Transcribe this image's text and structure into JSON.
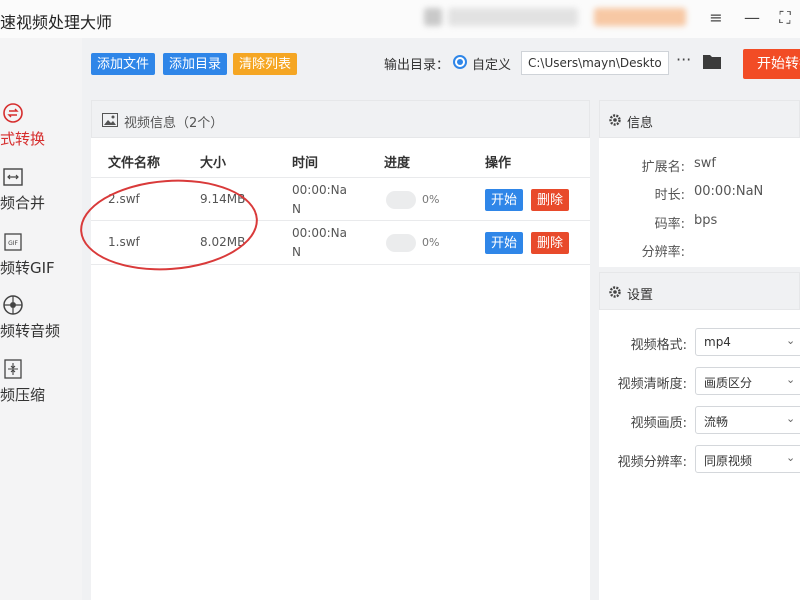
{
  "app": {
    "title": "优速视频处理大师"
  },
  "window": {
    "menu_icon": "menu-icon",
    "minimize_icon": "minimize-icon",
    "maximize_icon": "maximize-icon"
  },
  "sidebar": {
    "items": [
      {
        "label": "格式转换",
        "icon": "convert-icon",
        "active": true
      },
      {
        "label": "视频合并",
        "icon": "merge-icon",
        "active": false
      },
      {
        "label": "视频转GIF",
        "icon": "gif-icon",
        "active": false
      },
      {
        "label": "视频转音频",
        "icon": "audio-icon",
        "active": false
      },
      {
        "label": "视频压缩",
        "icon": "compress-icon",
        "active": false
      }
    ]
  },
  "toolbar": {
    "add_file": "添加文件",
    "add_dir": "添加目录",
    "clear_list": "清除列表",
    "output_label": "输出目录：",
    "custom_label": "自定义",
    "output_path": "C:\\Users\\mayn\\Desktop",
    "more": "···",
    "start_all": "开始转换"
  },
  "video_panel": {
    "title": "视频信息（2个）",
    "columns": [
      "文件名称",
      "大小",
      "时间",
      "进度",
      "操作"
    ],
    "rows": [
      {
        "name": "2.swf",
        "size": "9.14MB",
        "time_line1": "00:00:Na",
        "time_line2": "N",
        "progress": "0%",
        "start": "开始",
        "delete": "删除"
      },
      {
        "name": "1.swf",
        "size": "8.02MB",
        "time_line1": "00:00:Na",
        "time_line2": "N",
        "progress": "0%",
        "start": "开始",
        "delete": "删除"
      }
    ]
  },
  "info_panel": {
    "title": "信息",
    "fields": [
      {
        "label": "扩展名:",
        "value": "swf"
      },
      {
        "label": "时长:",
        "value": "00:00:NaN"
      },
      {
        "label": "码率:",
        "value": "bps"
      },
      {
        "label": "分辨率:",
        "value": ""
      }
    ]
  },
  "settings_panel": {
    "title": "设置",
    "fields": [
      {
        "label": "视频格式:",
        "value": "mp4"
      },
      {
        "label": "视频清晰度:",
        "value": "画质区分"
      },
      {
        "label": "视频画质:",
        "value": "流畅"
      },
      {
        "label": "视频分辨率:",
        "value": "同原视频"
      }
    ]
  },
  "colors": {
    "primary_blue": "#2f86e8",
    "clear_orange": "#f5a623",
    "start_red": "#f24c25",
    "active_red": "#d62e2e",
    "annotation_red": "#d93a3a"
  }
}
